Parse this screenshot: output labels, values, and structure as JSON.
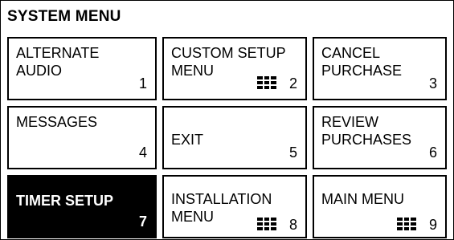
{
  "menu": {
    "title": "SYSTEM MENU",
    "tiles": [
      {
        "line1": "ALTERNATE",
        "line2": "AUDIO",
        "number": "1",
        "grid_icon": false,
        "selected": false
      },
      {
        "line1": "CUSTOM SETUP",
        "line2": "MENU",
        "number": "2",
        "grid_icon": true,
        "selected": false
      },
      {
        "line1": "CANCEL",
        "line2": "PURCHASE",
        "number": "3",
        "grid_icon": false,
        "selected": false
      },
      {
        "line1": "MESSAGES",
        "line2": "",
        "number": "4",
        "grid_icon": false,
        "selected": false
      },
      {
        "line1": "",
        "line2": "EXIT",
        "number": "5",
        "grid_icon": false,
        "selected": false
      },
      {
        "line1": "REVIEW",
        "line2": "PURCHASES",
        "number": "6",
        "grid_icon": false,
        "selected": false
      },
      {
        "line1": "TIMER SETUP",
        "line2": "",
        "number": "7",
        "grid_icon": false,
        "selected": true
      },
      {
        "line1": "INSTALLATION",
        "line2": "MENU",
        "number": "8",
        "grid_icon": true,
        "selected": false
      },
      {
        "line1": "MAIN MENU",
        "line2": "",
        "number": "9",
        "grid_icon": true,
        "selected": false
      }
    ]
  }
}
